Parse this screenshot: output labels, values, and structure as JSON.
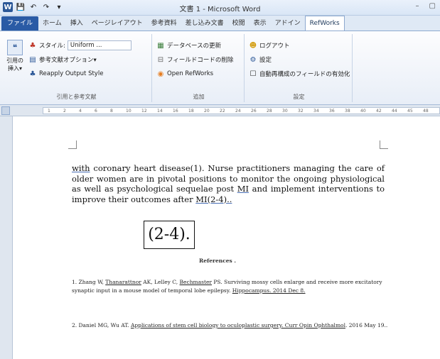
{
  "window": {
    "title": "文書 1 - Microsoft Word",
    "controls": [
      "–",
      "▢"
    ]
  },
  "qat": {
    "word_icon": "W",
    "save_icon": "💾",
    "undo_icon": "↶",
    "redo_icon": "↷",
    "customize_icon": "▾"
  },
  "tabs": [
    {
      "label": "ファイル",
      "active": false
    },
    {
      "label": "ホーム",
      "active": false
    },
    {
      "label": "挿入",
      "active": false
    },
    {
      "label": "ページレイアウト",
      "active": false
    },
    {
      "label": "参考資料",
      "active": false
    },
    {
      "label": "差し込み文書",
      "active": false
    },
    {
      "label": "校閲",
      "active": false
    },
    {
      "label": "表示",
      "active": false
    },
    {
      "label": "アドイン",
      "active": false
    },
    {
      "label": "RefWorks",
      "active": true
    }
  ],
  "ribbon": {
    "group1": {
      "label": "引用と参考文献",
      "insert_citation": "引用の\n挿入▾",
      "style_label": "スタイル:",
      "style_value": "Uniform ...",
      "bib_options": "参考文献オプション▾",
      "reapply": "Reapply Output Style"
    },
    "group2": {
      "label": "追加",
      "database": "データベースの更新",
      "remove_field": "フィールドコードの削除",
      "open": "Open RefWorks"
    },
    "group3": {
      "label": "設定",
      "logout": "ログアウト",
      "settings": "設定",
      "auto_update": "自動再構成のフィールドの有効化"
    }
  },
  "ruler": {
    "ticks": [
      "1",
      "2",
      "4",
      "6",
      "8",
      "10",
      "12",
      "14",
      "16",
      "18",
      "20",
      "22",
      "24",
      "26",
      "28",
      "30",
      "32",
      "34",
      "36",
      "38",
      "40",
      "42",
      "44",
      "45",
      "48"
    ]
  },
  "document": {
    "para_words": [
      "with",
      "coronary heart disease(1). Nurse practitioners managing the care of older women are in pivotal positions to monitor the ongoing physiological as well as psychological sequelae post",
      "MI",
      "and implement interventions to improve their outcomes after",
      "MI(2-4).."
    ],
    "citation": "(2-4).",
    "references_heading": "References .",
    "ref1": {
      "a": "1. Zhang W, ",
      "a_u": "Thanarattnor",
      "b": " AK, Lelley C, ",
      "b_u": "Bechmaster",
      "c": " PS. Surviving mossy cells enlarge and receive more excitatory synaptic input in a mouse model of temporal lobe epilepsy. ",
      "c_u": "Hippocampus. 2014 Dec 8."
    },
    "ref2": {
      "a": "2. Daniel MG, Wu AT. ",
      "a_u": "Applications of stem cell biology to oculoplastic surgery. Curr Opin Ophthalmol",
      "b": ". 2016 May 19.."
    }
  }
}
